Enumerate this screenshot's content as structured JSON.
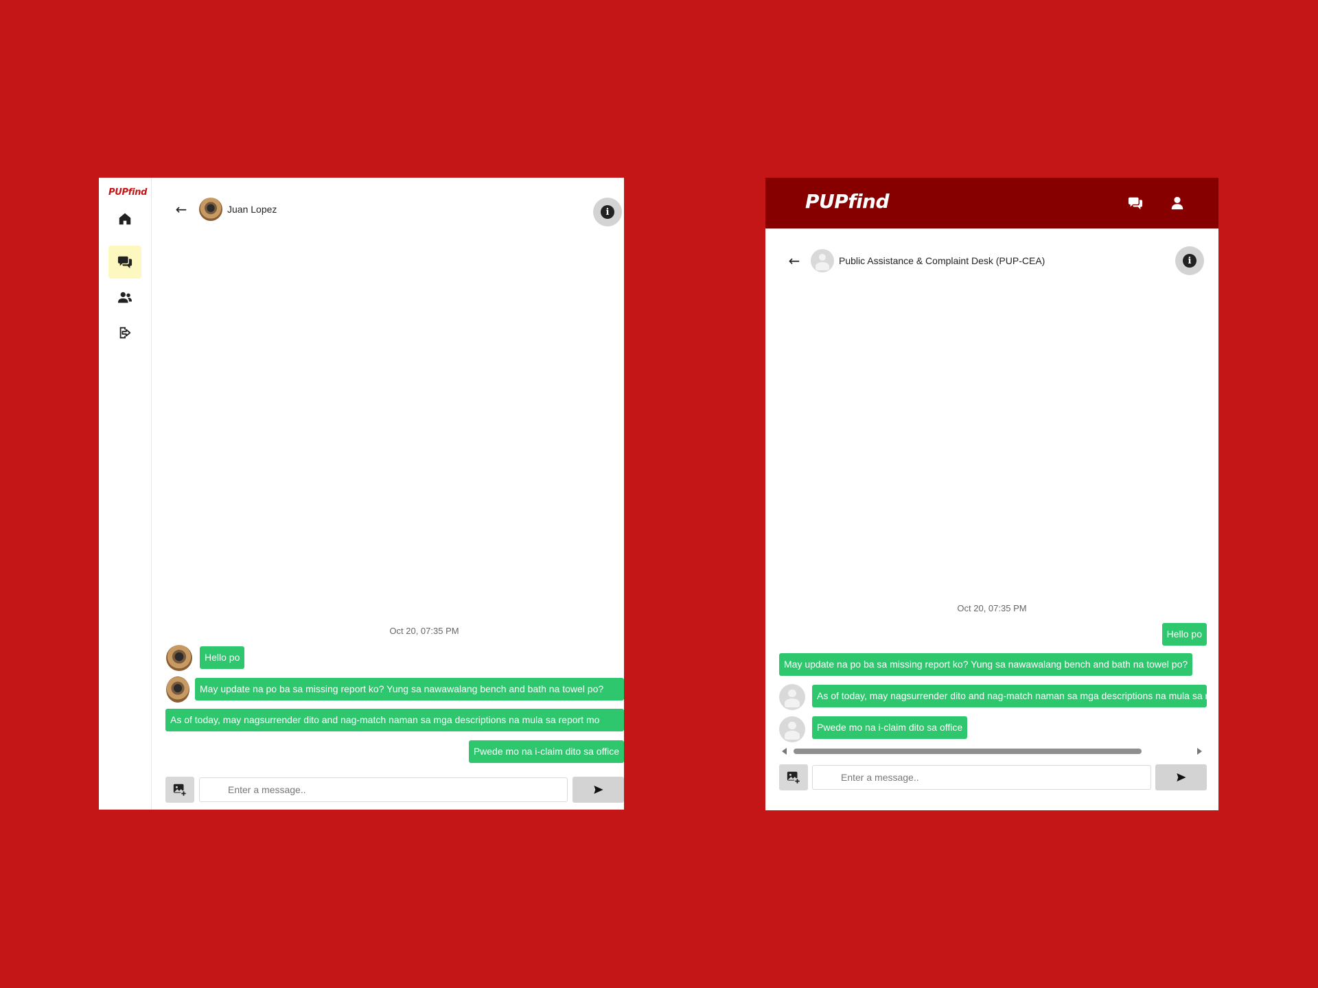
{
  "left_window": {
    "sidebar": {
      "logo": "PUPfind",
      "items": [
        {
          "name": "home",
          "icon": "home-icon",
          "active": false
        },
        {
          "name": "messages",
          "icon": "chat-bubbles-icon",
          "active": true
        },
        {
          "name": "users",
          "icon": "users-icon",
          "active": false
        },
        {
          "name": "logout",
          "icon": "logout-icon",
          "active": false
        }
      ]
    },
    "header": {
      "back_icon": "←",
      "contact_name": "Juan Lopez",
      "info_icon": "i"
    },
    "timestamp": "Oct 20, 07:35 PM",
    "messages": [
      {
        "text": "Hello po",
        "side": "received"
      },
      {
        "text": "May update na po ba sa missing report ko? Yung sa nawawalang bench and bath na towel po?",
        "side": "received"
      },
      {
        "text": "As of today, may nagsurrender dito and nag-match naman sa mga descriptions na mula sa report mo",
        "side": "sent"
      },
      {
        "text": "Pwede mo na i-claim dito sa office",
        "side": "sent"
      }
    ],
    "composer": {
      "placeholder": "Enter a message..",
      "attach_icon": "add-photo-icon",
      "send_icon": "send-icon"
    }
  },
  "right_window": {
    "topbar": {
      "logo": "PUPfind",
      "icons": [
        "chat-bubbles-icon",
        "user-icon"
      ]
    },
    "header": {
      "back_icon": "←",
      "contact_name": "Public Assistance & Complaint Desk (PUP-CEA)",
      "info_icon": "i"
    },
    "timestamp": "Oct 20, 07:35 PM",
    "messages": [
      {
        "text": "Hello po",
        "side": "sent"
      },
      {
        "text": "May update na po ba sa missing report ko? Yung sa nawawalang bench and bath na towel po?",
        "side": "sent"
      },
      {
        "text": "As of today, may nagsurrender dito and nag-match naman sa mga descriptions na mula sa report mo",
        "side": "received"
      },
      {
        "text": "Pwede mo na i-claim dito sa office",
        "side": "received"
      }
    ],
    "composer": {
      "placeholder": "Enter a message..",
      "attach_icon": "add-photo-icon",
      "send_icon": "send-icon"
    }
  },
  "colors": {
    "background": "#c41617",
    "bubble": "#2ec76e",
    "topbar": "#870000",
    "active_nav": "#fdf7c0"
  }
}
